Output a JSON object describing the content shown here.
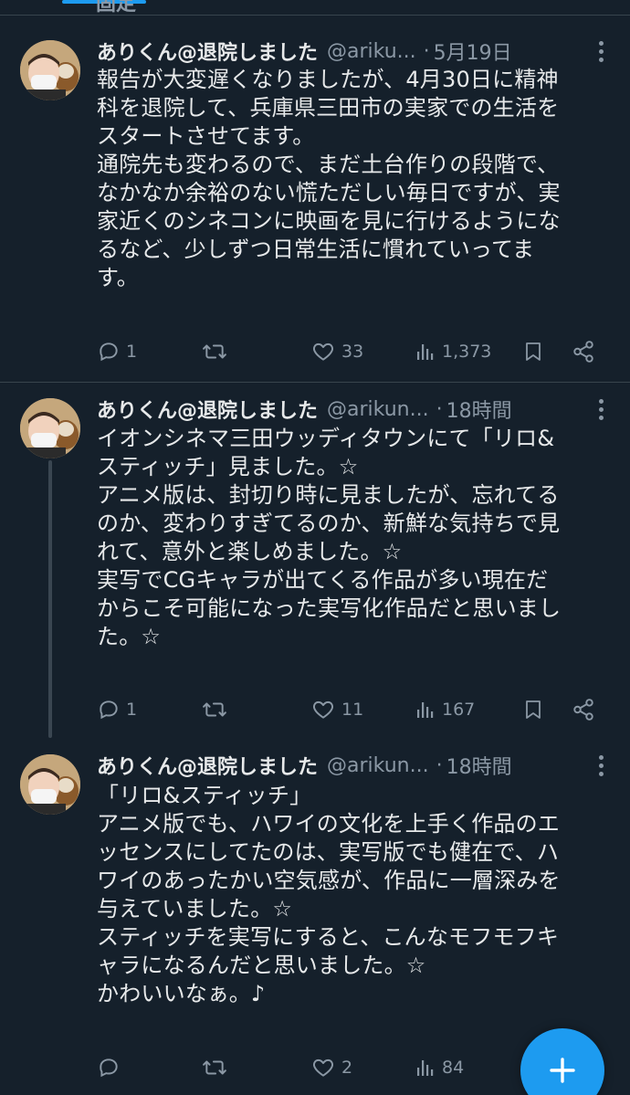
{
  "pinned_header": {
    "label": "固定"
  },
  "tweets": [
    {
      "name": "ありくん@退院しました",
      "handle": "@ariku...",
      "separator": "·",
      "time": "5月19日",
      "text": "報告が大変遅くなりましたが、4月30日に精神\n科を退院して、兵庫県三田市の実家での生活を\nスタートさせてます。\n通院先も変わるので、まだ土台作りの段階で、\nなかなか余裕のない慌ただしい毎日ですが、実\n家近くのシネコンに映画を見に行けるようにな\nるなど、少しずつ日常生活に慣れていってま\nす。",
      "replies": "1",
      "retweets": "",
      "likes": "33",
      "views": "1,373"
    },
    {
      "name": "ありくん@退院しました",
      "handle": "@arikun...",
      "separator": "·",
      "time": "18時間",
      "text": "イオンシネマ三田ウッディタウンにて「リロ&\nスティッチ」見ました。☆\nアニメ版は、封切り時に見ましたが、忘れてる\nのか、変わりすぎてるのか、新鮮な気持ちで見\nれて、意外と楽しめました。☆\n実写でCGキャラが出てくる作品が多い現在だ\nからこそ可能になった実写化作品だと思いまし\nた。☆",
      "replies": "1",
      "retweets": "",
      "likes": "11",
      "views": "167"
    },
    {
      "name": "ありくん@退院しました",
      "handle": "@arikun...",
      "separator": "·",
      "time": "18時間",
      "text": "「リロ&スティッチ」\nアニメ版でも、ハワイの文化を上手く作品のエ\nッセンスにしてたのは、実写版でも健在で、ハ\nワイのあったかい空気感が、作品に一層深みを\n与えていました。☆\nスティッチを実写にすると、こんなモフモフキ\nャラになるんだと思いました。☆\nかわいいなぁ。♪",
      "replies": "",
      "retweets": "",
      "likes": "2",
      "views": "84"
    }
  ],
  "icons": {
    "reply": "reply-icon",
    "retweet": "retweet-icon",
    "like": "heart-icon",
    "views": "views-icon",
    "bookmark": "bookmark-icon",
    "share": "share-icon",
    "more": "more-icon",
    "compose": "plus-icon"
  },
  "colors": {
    "background": "#15202b",
    "text": "#e7e9ea",
    "muted": "#8b98a5",
    "accent": "#1d9bf0",
    "divider": "#38444d"
  }
}
